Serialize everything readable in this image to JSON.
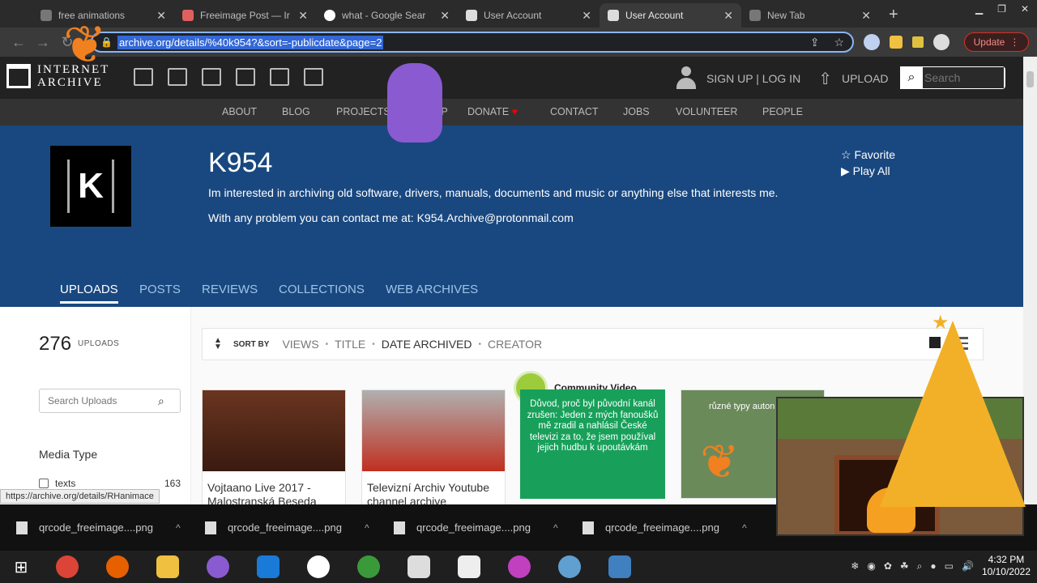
{
  "browser": {
    "tabs": [
      {
        "title": "free animations",
        "active": false
      },
      {
        "title": "Freeimage Post — Ir",
        "active": false
      },
      {
        "title": "what - Google Sear",
        "active": false
      },
      {
        "title": "User Account",
        "active": false
      },
      {
        "title": "User Account",
        "active": true
      },
      {
        "title": "New Tab",
        "active": false
      }
    ],
    "url": "archive.org/details/%40k954?&sort=-publicdate&page=2",
    "update_label": "Update"
  },
  "ia": {
    "logo_line1": "INTERNET",
    "logo_line2": "ARCHIVE",
    "signup_label": "SIGN UP | LOG IN",
    "upload_label": "UPLOAD",
    "search_placeholder": "Search",
    "menu": [
      "ABOUT",
      "BLOG",
      "PROJECTS",
      "HELP",
      "DONATE",
      "CONTACT",
      "JOBS",
      "VOLUNTEER",
      "PEOPLE"
    ]
  },
  "profile": {
    "name": "K954",
    "description": "Im interested in archiving old software, drivers, manuals, documents and music or anything else that interests me.",
    "contact": "With any problem you can contact me at: K954.Archive@protonmail.com",
    "favorite_label": "Favorite",
    "play_all_label": "Play All",
    "tabs": [
      "UPLOADS",
      "POSTS",
      "REVIEWS",
      "COLLECTIONS",
      "WEB ARCHIVES"
    ],
    "active_tab": "UPLOADS"
  },
  "sidebar": {
    "count": "276",
    "count_label": "UPLOADS",
    "search_placeholder": "Search Uploads",
    "media_type_heading": "Media Type",
    "facets": [
      {
        "label": "texts",
        "count": "163"
      }
    ]
  },
  "sort": {
    "label": "SORT BY",
    "options": [
      "VIEWS",
      "TITLE",
      "DATE ARCHIVED",
      "CREATOR"
    ],
    "selected": "DATE ARCHIVED"
  },
  "items": [
    {
      "title": "Vojtaano Live 2017 - Malostranská Beseda",
      "thumb_color": "#5a2a1a"
    },
    {
      "title": "Televizní Archiv Youtube channel archive",
      "thumb_color": "#a8a8a8"
    }
  ],
  "community_badge": "Community Video",
  "czech_text": "Důvod, proč byl původní kanál zrušen: Jeden z mých fanoušků mě zradil a nahlásil České televizi za to, že jsem používal jejich hudbu k upoutávkám",
  "third_thumb_text": "různé typy auton",
  "status_url": "https://archive.org/details/RHanimace",
  "downloads": [
    "qrcode_freeimage....png",
    "qrcode_freeimage....png",
    "qrcode_freeimage....png",
    "qrcode_freeimage....png"
  ],
  "taskbar": {
    "time": "4:32 PM",
    "date": "10/10/2022"
  }
}
